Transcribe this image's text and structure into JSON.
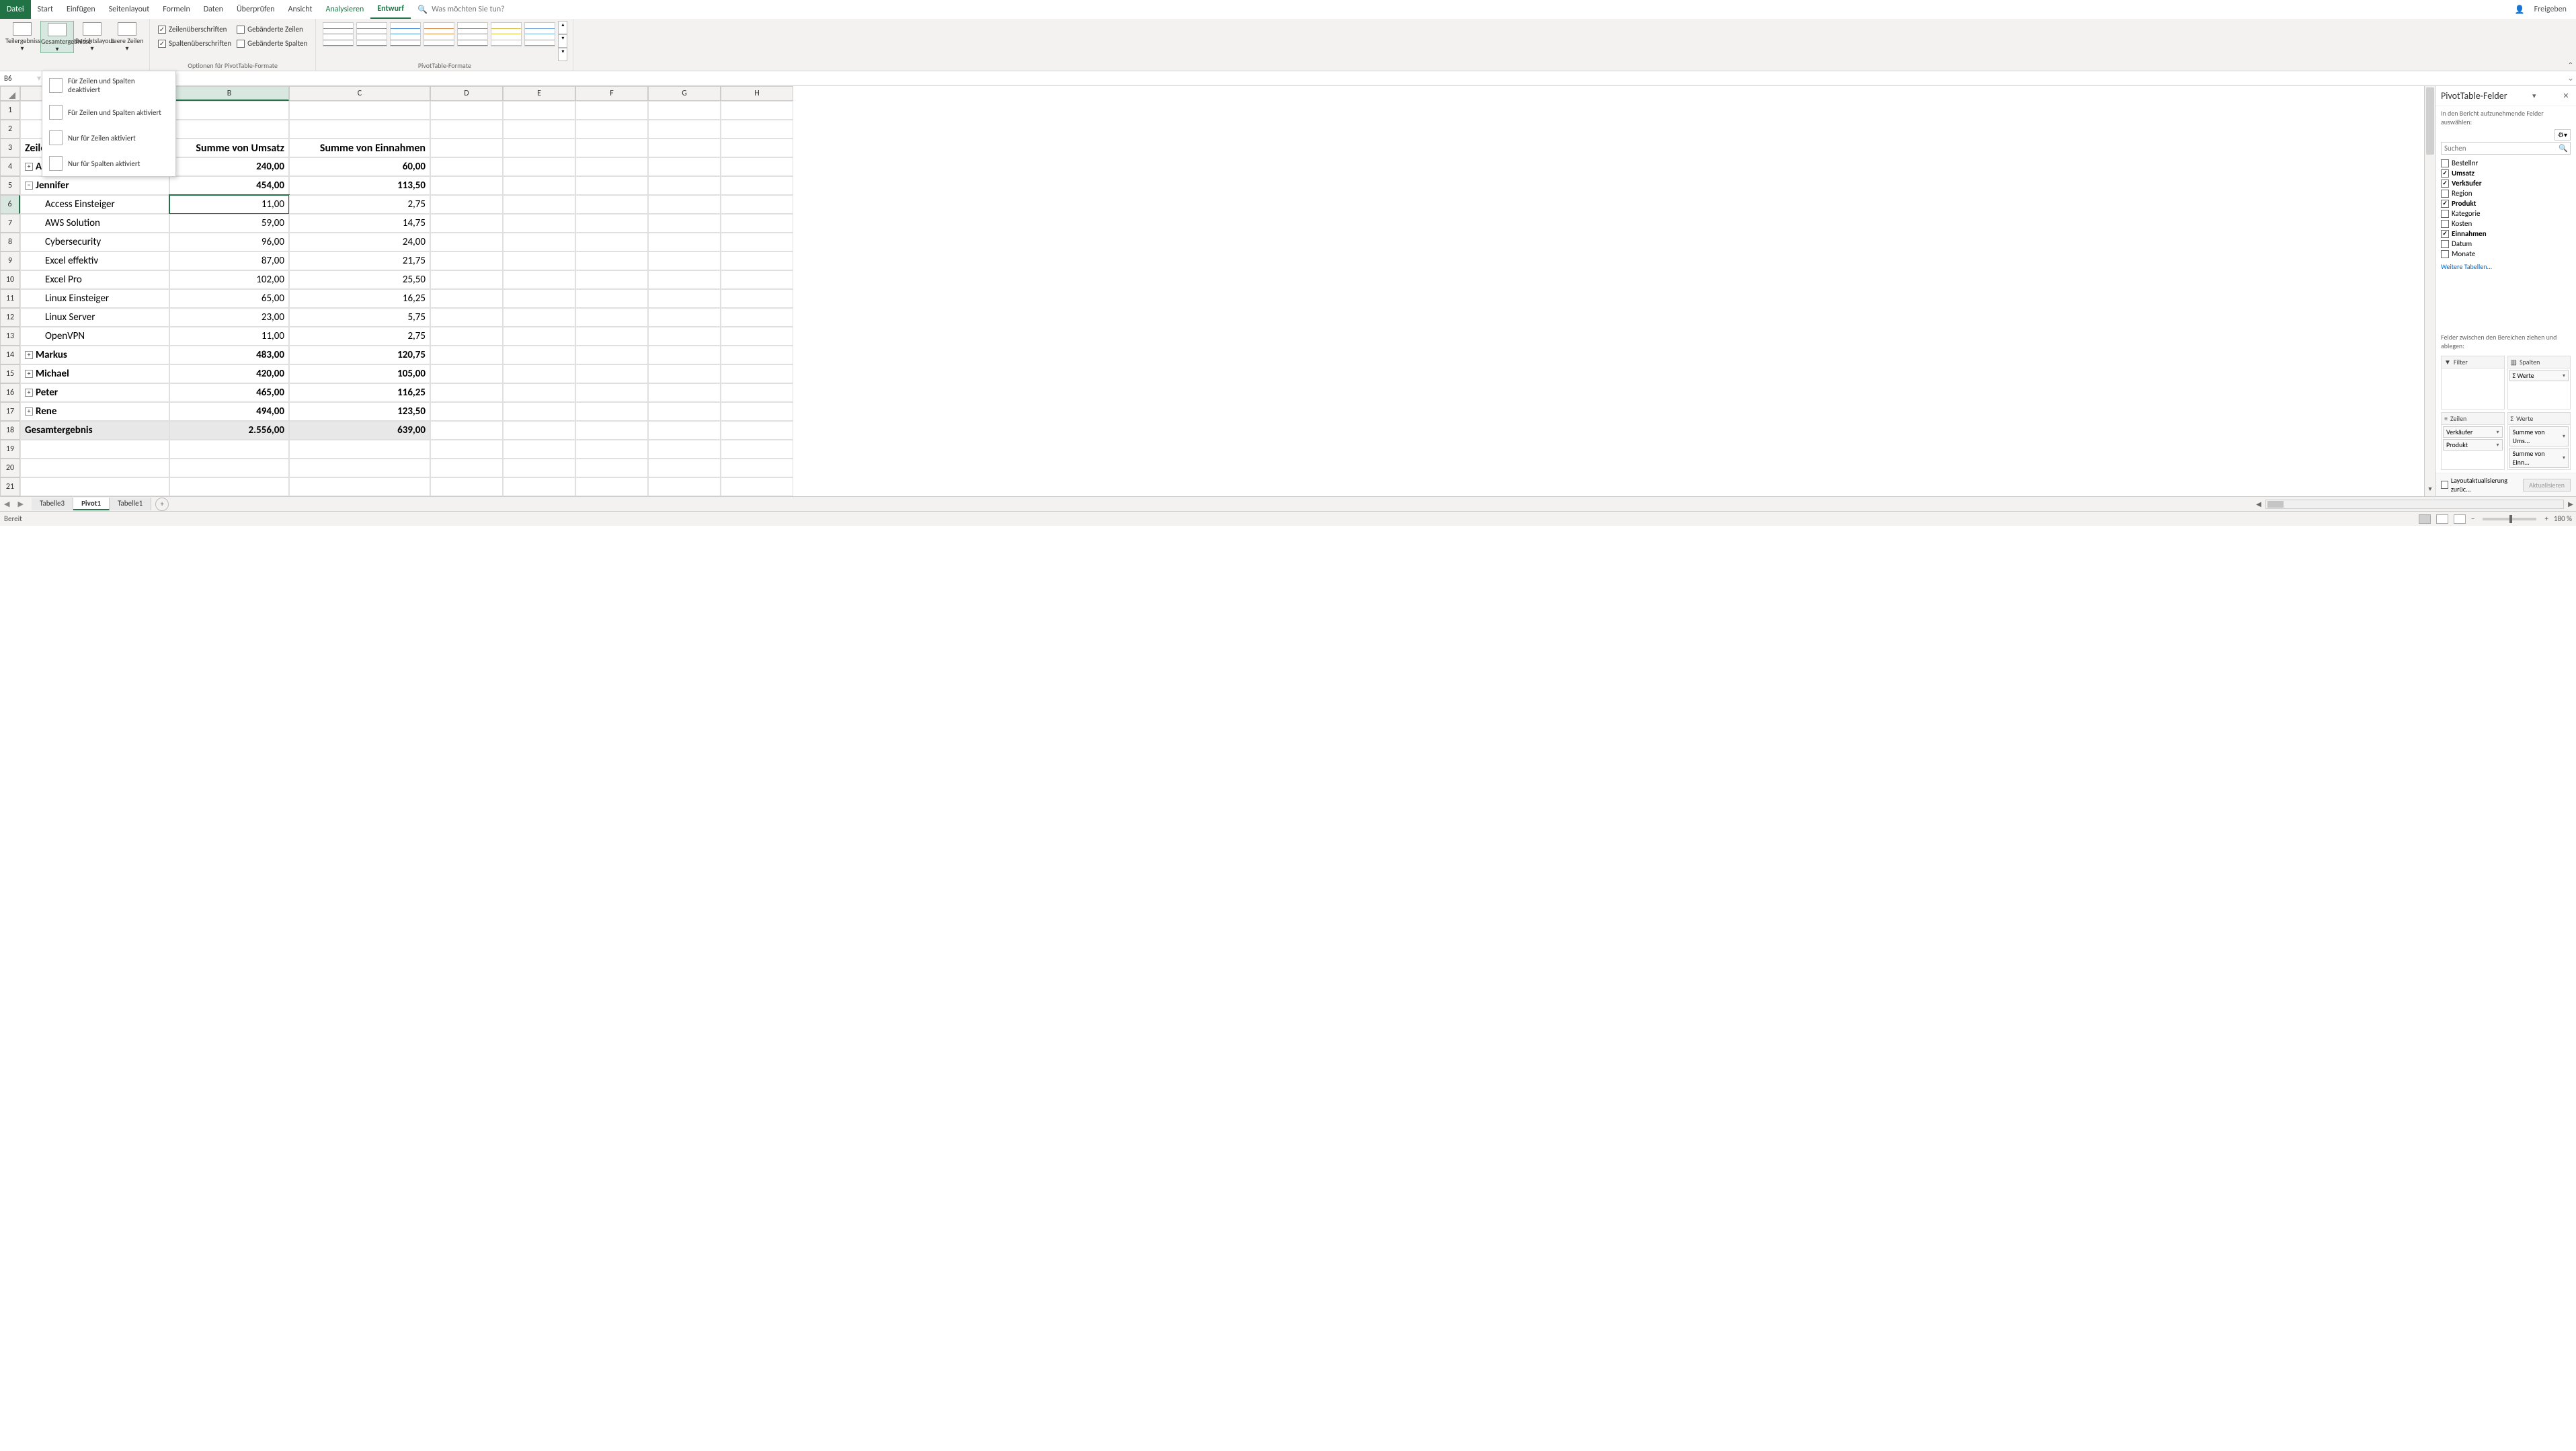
{
  "tabs": [
    "Datei",
    "Start",
    "Einfügen",
    "Seitenlayout",
    "Formeln",
    "Daten",
    "Überprüfen",
    "Ansicht",
    "Analysieren",
    "Entwurf"
  ],
  "active_tab": "Entwurf",
  "tellme": "Was möchten Sie tun?",
  "share": "Freigeben",
  "ribbon": {
    "layout_btns": [
      "Teilergebnisse",
      "Gesamtergebnisse",
      "Berichtslayout",
      "Leere Zeilen"
    ],
    "active_btn": "Gesamtergebnisse",
    "group1_label": "",
    "options": {
      "row_headers": "Zeilenüberschriften",
      "col_headers": "Spaltenüberschriften",
      "banded_rows": "Gebänderte Zeilen",
      "banded_cols": "Gebänderte Spalten",
      "row_checked": true,
      "col_checked": true,
      "banded_rows_checked": false,
      "banded_cols_checked": false,
      "group_label": "Optionen für PivotTable-Formate"
    },
    "styles_label": "PivotTable-Formate"
  },
  "dropdown": [
    "Für Zeilen und Spalten deaktiviert",
    "Für Zeilen und Spalten aktiviert",
    "Nur für Zeilen aktiviert",
    "Nur für Spalten aktiviert"
  ],
  "name_box": "B6",
  "col_heads": [
    "B",
    "C",
    "D",
    "E",
    "F",
    "G",
    "H"
  ],
  "selected_col": "B",
  "selected_row": 6,
  "pivot": {
    "headers": [
      "Zeilenbeschriftungen",
      "Summe von Umsatz",
      "Summe von Einnahmen"
    ],
    "rows": [
      {
        "r": 4,
        "type": "grp",
        "exp": "plus",
        "label": "Anna",
        "umsatz": "240,00",
        "ein": "60,00"
      },
      {
        "r": 5,
        "type": "grp",
        "exp": "minus",
        "label": "Jennifer",
        "umsatz": "454,00",
        "ein": "113,50"
      },
      {
        "r": 6,
        "type": "sub",
        "label": "Access Einsteiger",
        "umsatz": "11,00",
        "ein": "2,75",
        "sel": true
      },
      {
        "r": 7,
        "type": "sub",
        "label": "AWS Solution",
        "umsatz": "59,00",
        "ein": "14,75"
      },
      {
        "r": 8,
        "type": "sub",
        "label": "Cybersecurity",
        "umsatz": "96,00",
        "ein": "24,00"
      },
      {
        "r": 9,
        "type": "sub",
        "label": "Excel effektiv",
        "umsatz": "87,00",
        "ein": "21,75"
      },
      {
        "r": 10,
        "type": "sub",
        "label": "Excel Pro",
        "umsatz": "102,00",
        "ein": "25,50"
      },
      {
        "r": 11,
        "type": "sub",
        "label": "Linux Einsteiger",
        "umsatz": "65,00",
        "ein": "16,25"
      },
      {
        "r": 12,
        "type": "sub",
        "label": "Linux Server",
        "umsatz": "23,00",
        "ein": "5,75"
      },
      {
        "r": 13,
        "type": "sub",
        "label": "OpenVPN",
        "umsatz": "11,00",
        "ein": "2,75"
      },
      {
        "r": 14,
        "type": "grp",
        "exp": "plus",
        "label": "Markus",
        "umsatz": "483,00",
        "ein": "120,75"
      },
      {
        "r": 15,
        "type": "grp",
        "exp": "plus",
        "label": "Michael",
        "umsatz": "420,00",
        "ein": "105,00"
      },
      {
        "r": 16,
        "type": "grp",
        "exp": "plus",
        "label": "Peter",
        "umsatz": "465,00",
        "ein": "116,25"
      },
      {
        "r": 17,
        "type": "grp",
        "exp": "plus",
        "label": "Rene",
        "umsatz": "494,00",
        "ein": "123,50"
      },
      {
        "r": 18,
        "type": "total",
        "label": "Gesamtergebnis",
        "umsatz": "2.556,00",
        "ein": "639,00"
      }
    ]
  },
  "pane": {
    "title": "PivotTable-Felder",
    "sub": "In den Bericht aufzunehmende Felder auswählen:",
    "search_ph": "Suchen",
    "fields": [
      {
        "name": "Bestellnr",
        "ck": false
      },
      {
        "name": "Umsatz",
        "ck": true
      },
      {
        "name": "Verkäufer",
        "ck": true
      },
      {
        "name": "Region",
        "ck": false
      },
      {
        "name": "Produkt",
        "ck": true
      },
      {
        "name": "Kategorie",
        "ck": false
      },
      {
        "name": "Kosten",
        "ck": false
      },
      {
        "name": "Einnahmen",
        "ck": true
      },
      {
        "name": "Datum",
        "ck": false
      },
      {
        "name": "Monate",
        "ck": false
      }
    ],
    "more_tables": "Weitere Tabellen...",
    "drag_hint": "Felder zwischen den Bereichen ziehen und ablegen:",
    "zones": {
      "filter": {
        "label": "Filter",
        "items": []
      },
      "cols": {
        "label": "Spalten",
        "items": [
          "Σ Werte"
        ]
      },
      "rows": {
        "label": "Zeilen",
        "items": [
          "Verkäufer",
          "Produkt"
        ]
      },
      "values": {
        "label": "Werte",
        "items": [
          "Summe von Ums...",
          "Summe von Einn..."
        ]
      }
    },
    "defer": "Layoutaktualisierung zurüc...",
    "update": "Aktualisieren"
  },
  "sheet_tabs": [
    "Tabelle3",
    "Pivot1",
    "Tabelle1"
  ],
  "active_sheet": "Pivot1",
  "status": "Bereit",
  "zoom": "180 %"
}
